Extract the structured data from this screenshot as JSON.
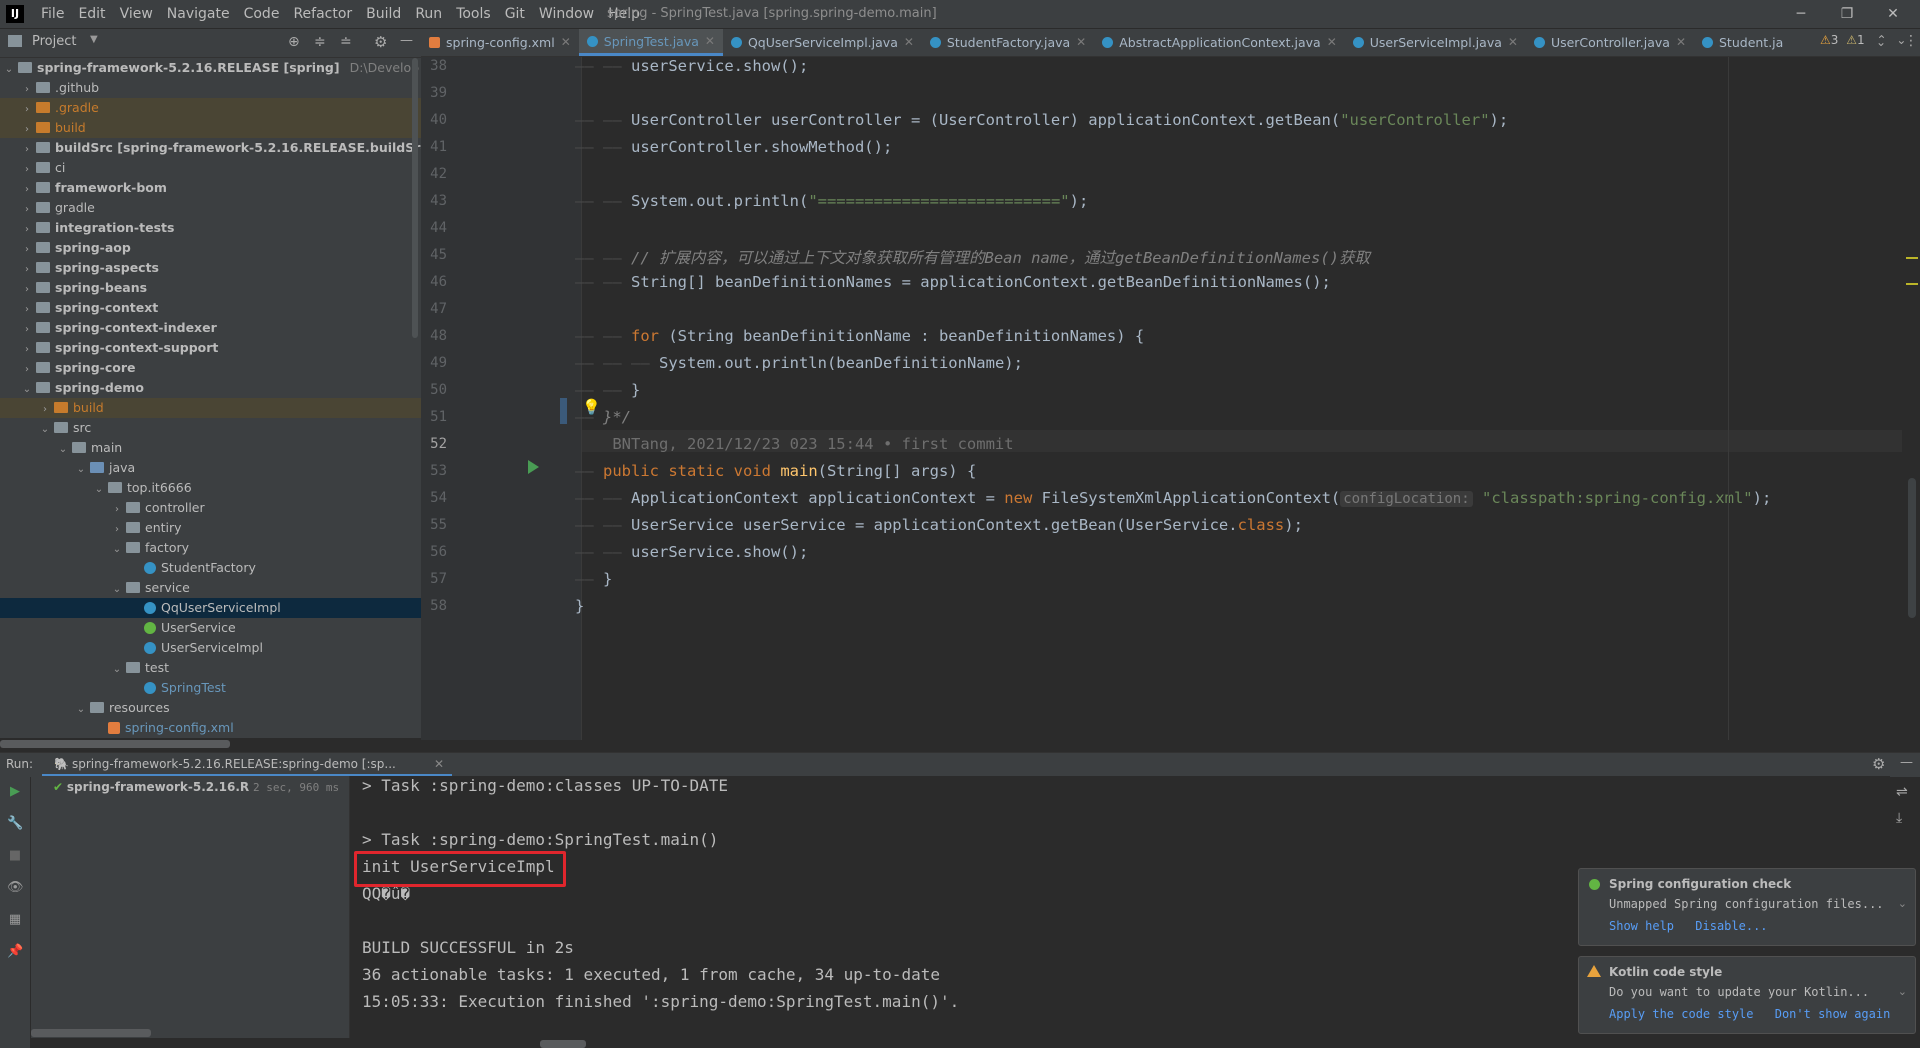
{
  "menubar": {
    "logo": "IJ",
    "items": [
      "File",
      "Edit",
      "View",
      "Navigate",
      "Code",
      "Refactor",
      "Build",
      "Run",
      "Tools",
      "Git",
      "Window",
      "Help"
    ],
    "window_title": "spring - SpringTest.java [spring.spring-demo.main]"
  },
  "project_panel": {
    "title": "Project",
    "root_label": "spring-framework-5.2.16.RELEASE [spring]",
    "root_path": "D:\\Develop",
    "tree": [
      {
        "label": ".github",
        "indent": 1,
        "arrow": "›"
      },
      {
        "label": ".gradle",
        "indent": 1,
        "arrow": "›",
        "style": "orange"
      },
      {
        "label": "build",
        "indent": 1,
        "arrow": "›",
        "style": "orange"
      },
      {
        "label": "buildSrc [spring-framework-5.2.16.RELEASE.buildSrc]",
        "indent": 1,
        "arrow": "›",
        "style": "bold"
      },
      {
        "label": "ci",
        "indent": 1,
        "arrow": "›"
      },
      {
        "label": "framework-bom",
        "indent": 1,
        "arrow": "›",
        "style": "bold"
      },
      {
        "label": "gradle",
        "indent": 1,
        "arrow": "›"
      },
      {
        "label": "integration-tests",
        "indent": 1,
        "arrow": "›",
        "style": "bold"
      },
      {
        "label": "spring-aop",
        "indent": 1,
        "arrow": "›",
        "style": "bold"
      },
      {
        "label": "spring-aspects",
        "indent": 1,
        "arrow": "›",
        "style": "bold"
      },
      {
        "label": "spring-beans",
        "indent": 1,
        "arrow": "›",
        "style": "bold"
      },
      {
        "label": "spring-context",
        "indent": 1,
        "arrow": "›",
        "style": "bold"
      },
      {
        "label": "spring-context-indexer",
        "indent": 1,
        "arrow": "›",
        "style": "bold"
      },
      {
        "label": "spring-context-support",
        "indent": 1,
        "arrow": "›",
        "style": "bold"
      },
      {
        "label": "spring-core",
        "indent": 1,
        "arrow": "›",
        "style": "bold"
      },
      {
        "label": "spring-demo",
        "indent": 1,
        "arrow": "⌄",
        "style": "bold"
      },
      {
        "label": "build",
        "indent": 2,
        "arrow": "›",
        "style": "orange"
      },
      {
        "label": "src",
        "indent": 2,
        "arrow": "⌄"
      },
      {
        "label": "main",
        "indent": 3,
        "arrow": "⌄"
      },
      {
        "label": "java",
        "indent": 4,
        "arrow": "⌄",
        "style": "blue"
      },
      {
        "label": "top.it6666",
        "indent": 5,
        "arrow": "⌄"
      },
      {
        "label": "controller",
        "indent": 6,
        "arrow": "›"
      },
      {
        "label": "entiry",
        "indent": 6,
        "arrow": "›"
      },
      {
        "label": "factory",
        "indent": 6,
        "arrow": "⌄"
      },
      {
        "label": "StudentFactory",
        "indent": 7,
        "arrow": "",
        "kind": "class"
      },
      {
        "label": "service",
        "indent": 6,
        "arrow": "⌄"
      },
      {
        "label": "QqUserServiceImpl",
        "indent": 7,
        "arrow": "",
        "kind": "class",
        "selected": true
      },
      {
        "label": "UserService",
        "indent": 7,
        "arrow": "",
        "kind": "interface"
      },
      {
        "label": "UserServiceImpl",
        "indent": 7,
        "arrow": "",
        "kind": "class"
      },
      {
        "label": "test",
        "indent": 6,
        "arrow": "⌄"
      },
      {
        "label": "SpringTest",
        "indent": 7,
        "arrow": "",
        "kind": "class",
        "style": "bluetext"
      },
      {
        "label": "resources",
        "indent": 4,
        "arrow": "⌄"
      },
      {
        "label": "spring-config.xml",
        "indent": 5,
        "arrow": "",
        "kind": "xml",
        "style": "bluetext"
      },
      {
        "label": "test",
        "indent": 3,
        "arrow": "›"
      }
    ]
  },
  "tabs": [
    {
      "label": "spring-config.xml",
      "kind": "xml",
      "active": false
    },
    {
      "label": "SpringTest.java",
      "kind": "class",
      "active": true
    },
    {
      "label": "QqUserServiceImpl.java",
      "kind": "class",
      "active": false
    },
    {
      "label": "StudentFactory.java",
      "kind": "class",
      "active": false
    },
    {
      "label": "AbstractApplicationContext.java",
      "kind": "class",
      "active": false
    },
    {
      "label": "UserServiceImpl.java",
      "kind": "class",
      "active": false
    },
    {
      "label": "UserController.java",
      "kind": "class",
      "active": false
    },
    {
      "label": "Student.ja",
      "kind": "class",
      "active": false
    }
  ],
  "inspections": {
    "warnings": "3",
    "weak_warnings": "1"
  },
  "editor": {
    "lines": [
      {
        "num": "38",
        "guides": "—— —— ",
        "html": "userService.show();"
      },
      {
        "num": "39",
        "guides": "",
        "html": ""
      },
      {
        "num": "40",
        "guides": "—— —— ",
        "html": "UserController userController = (UserController) applicationContext.getBean(<span class=\"str\">\"userController\"</span>);"
      },
      {
        "num": "41",
        "guides": "—— —— ",
        "html": "userController.showMethod();"
      },
      {
        "num": "42",
        "guides": "",
        "html": ""
      },
      {
        "num": "43",
        "guides": "—— —— ",
        "html": "System.out.println(<span class=\"str\">\"==========================\"</span>);"
      },
      {
        "num": "44",
        "guides": "",
        "html": ""
      },
      {
        "num": "45",
        "guides": "—— —— ",
        "html": "<span class=\"cmt\">// 扩展内容，可以通过上下文对象获取所有管理的Bean name，通过getBeanDefinitionNames()获取</span>"
      },
      {
        "num": "46",
        "guides": "—— —— ",
        "html": "String[] beanDefinitionNames = applicationContext.getBeanDefinitionNames();"
      },
      {
        "num": "47",
        "guides": "",
        "html": ""
      },
      {
        "num": "48",
        "guides": "—— —— ",
        "html": "<span class=\"kw\">for</span> (String beanDefinitionName : beanDefinitionNames) {"
      },
      {
        "num": "49",
        "guides": "—— —— —— ",
        "html": "System.out.println(beanDefinitionName);"
      },
      {
        "num": "50",
        "guides": "—— —— ",
        "html": "}"
      },
      {
        "num": "51",
        "guides": "—— ",
        "html": "<span class=\"cmt\">}*/</span>"
      },
      {
        "num": "52",
        "guides": "    ",
        "html": "<span class=\"blame\">BNTang, 2021/12/23 023 15:44 • first commit</span>"
      },
      {
        "num": "53",
        "guides": "—— ",
        "html": "<span class=\"kw\">public static void</span> <span style=\"color:#ffc66d\">main</span>(String[] args) {"
      },
      {
        "num": "54",
        "guides": "—— —— ",
        "html": "ApplicationContext applicationContext = <span class=\"kw\">new</span> FileSystemXmlApplicationContext(<span class=\"hint\">configLocation:</span> <span class=\"str\">\"classpath:spring-config.xml\"</span>);"
      },
      {
        "num": "55",
        "guides": "—— —— ",
        "html": "UserService userService = applicationContext.getBean(UserService.<span class=\"kw\">class</span>);"
      },
      {
        "num": "56",
        "guides": "—— —— ",
        "html": "userService.show();"
      },
      {
        "num": "57",
        "guides": "—— ",
        "html": "}"
      },
      {
        "num": "58",
        "guides": "",
        "html": "}"
      }
    ]
  },
  "run_panel": {
    "label": "Run:",
    "tab_title": "spring-framework-5.2.16.RELEASE:spring-demo [:sp...",
    "tree_item": "spring-framework-5.2.16.R",
    "tree_time": "2 sec, 960 ms",
    "console": [
      "> Task :spring-demo:classes UP-TO-DATE",
      "",
      "> Task :spring-demo:SpringTest.main()",
      "init UserServiceImpl",
      "QQ�û�",
      "",
      "BUILD SUCCESSFUL in 2s",
      "36 actionable tasks: 1 executed, 1 from cache, 34 up-to-date",
      "15:05:33: Execution finished ':spring-demo:SpringTest.main()'."
    ]
  },
  "notifications": [
    {
      "title": "Spring configuration check",
      "body": "Unmapped Spring configuration files...",
      "links": [
        "Show help",
        "Disable..."
      ]
    },
    {
      "title": "Kotlin code style",
      "body": "Do you want to update your Kotlin...",
      "links": [
        "Apply the code style",
        "Don't show again"
      ]
    }
  ],
  "colors": {
    "accent": "#4a88c7",
    "highlight_box": "#e0262d",
    "success": "#62b543"
  }
}
